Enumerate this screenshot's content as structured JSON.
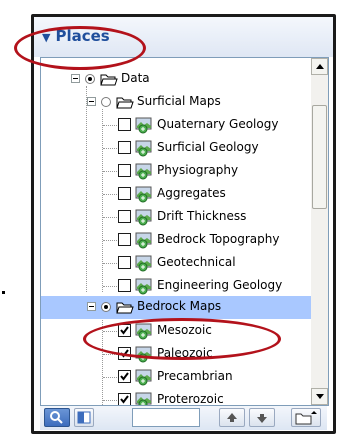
{
  "panel": {
    "title": "Places",
    "collapse_glyph": "▼"
  },
  "tree": {
    "root": {
      "label": "Data",
      "expanded": true,
      "radio_selected": true
    },
    "surficial": {
      "label": "Surficial Maps",
      "expanded": true,
      "radio_selected": false,
      "items": [
        {
          "label": "Quaternary Geology",
          "checked": false
        },
        {
          "label": "Surficial Geology",
          "checked": false
        },
        {
          "label": "Physiography",
          "checked": false
        },
        {
          "label": "Aggregates",
          "checked": false
        },
        {
          "label": "Drift Thickness",
          "checked": false
        },
        {
          "label": "Bedrock Topography",
          "checked": false
        },
        {
          "label": "Geotechnical",
          "checked": false
        },
        {
          "label": "Engineering Geology",
          "checked": false
        }
      ]
    },
    "bedrock": {
      "label": "Bedrock Maps",
      "expanded": true,
      "radio_selected": true,
      "selected": true,
      "items": [
        {
          "label": "Mesozoic",
          "checked": true
        },
        {
          "label": "Paleozoic",
          "checked": true
        },
        {
          "label": "Precambrian",
          "checked": true
        },
        {
          "label": "Proterozoic",
          "checked": true
        }
      ]
    }
  },
  "colors": {
    "title": "#1f4e9c",
    "selection": "#a9c8ff",
    "annotation": "#b3121b"
  },
  "toolbar": {
    "search_value": "",
    "icons": [
      "search-icon",
      "split-view-icon",
      "move-up-icon",
      "move-down-icon",
      "folder-menu-icon"
    ]
  }
}
